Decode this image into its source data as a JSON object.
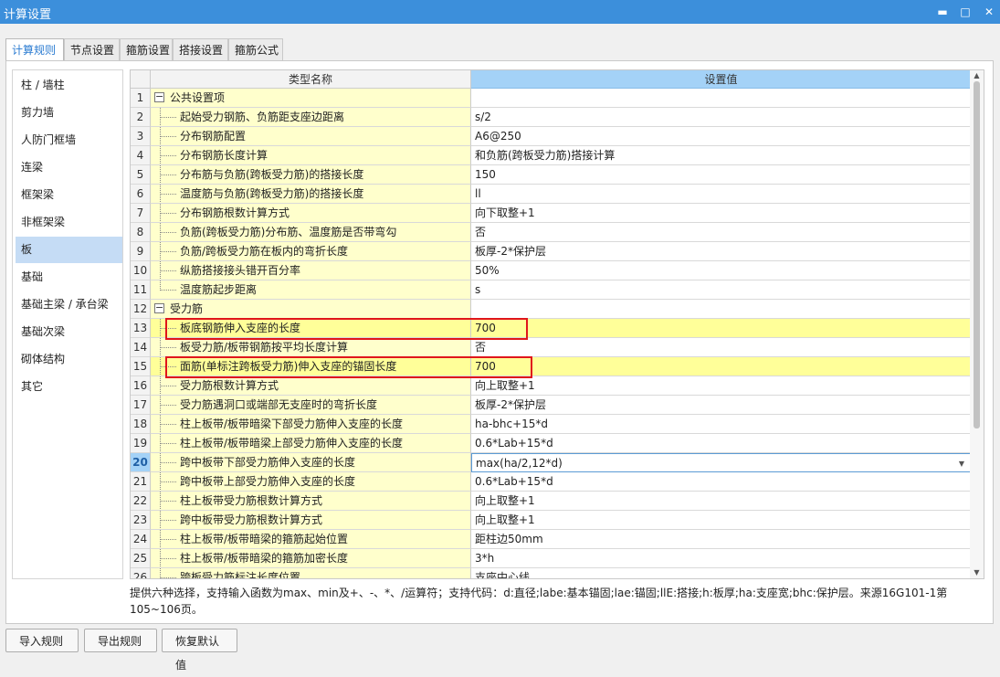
{
  "window": {
    "title": "计算设置",
    "min": "▬",
    "max": "□",
    "close": "✕"
  },
  "tabs": [
    "计算规则",
    "节点设置",
    "箍筋设置",
    "搭接设置",
    "箍筋公式"
  ],
  "categories": [
    "柱 / 墙柱",
    "剪力墙",
    "人防门框墙",
    "连梁",
    "框架梁",
    "非框架梁",
    "板",
    "基础",
    "基础主梁 / 承台梁",
    "基础次梁",
    "砌体结构",
    "其它"
  ],
  "grid": {
    "col_name": "类型名称",
    "col_value": "设置值",
    "rows": [
      {
        "num": "1",
        "name": "公共设置项",
        "value": "",
        "group": true
      },
      {
        "num": "2",
        "name": "起始受力钢筋、负筋距支座边距离",
        "value": "s/2"
      },
      {
        "num": "3",
        "name": "分布钢筋配置",
        "value": "A6@250"
      },
      {
        "num": "4",
        "name": "分布钢筋长度计算",
        "value": "和负筋(跨板受力筋)搭接计算"
      },
      {
        "num": "5",
        "name": "分布筋与负筋(跨板受力筋)的搭接长度",
        "value": "150"
      },
      {
        "num": "6",
        "name": "温度筋与负筋(跨板受力筋)的搭接长度",
        "value": "ll"
      },
      {
        "num": "7",
        "name": "分布钢筋根数计算方式",
        "value": "向下取整+1"
      },
      {
        "num": "8",
        "name": "负筋(跨板受力筋)分布筋、温度筋是否带弯勾",
        "value": "否"
      },
      {
        "num": "9",
        "name": "负筋/跨板受力筋在板内的弯折长度",
        "value": "板厚-2*保护层"
      },
      {
        "num": "10",
        "name": "纵筋搭接接头错开百分率",
        "value": "50%"
      },
      {
        "num": "11",
        "name": "温度筋起步距离",
        "value": "s"
      },
      {
        "num": "12",
        "name": "受力筋",
        "value": "",
        "group": true
      },
      {
        "num": "13",
        "name": "板底钢筋伸入支座的长度",
        "value": "700"
      },
      {
        "num": "14",
        "name": "板受力筋/板带钢筋按平均长度计算",
        "value": "否"
      },
      {
        "num": "15",
        "name": "面筋(单标注跨板受力筋)伸入支座的锚固长度",
        "value": "700"
      },
      {
        "num": "16",
        "name": "受力筋根数计算方式",
        "value": "向上取整+1"
      },
      {
        "num": "17",
        "name": "受力筋遇洞口或端部无支座时的弯折长度",
        "value": "板厚-2*保护层"
      },
      {
        "num": "18",
        "name": "柱上板带/板带暗梁下部受力筋伸入支座的长度",
        "value": "ha-bhc+15*d"
      },
      {
        "num": "19",
        "name": "柱上板带/板带暗梁上部受力筋伸入支座的长度",
        "value": "0.6*Lab+15*d"
      },
      {
        "num": "20",
        "name": "跨中板带下部受力筋伸入支座的长度",
        "value": "max(ha/2,12*d)"
      },
      {
        "num": "21",
        "name": "跨中板带上部受力筋伸入支座的长度",
        "value": "0.6*Lab+15*d"
      },
      {
        "num": "22",
        "name": "柱上板带受力筋根数计算方式",
        "value": "向上取整+1"
      },
      {
        "num": "23",
        "name": "跨中板带受力筋根数计算方式",
        "value": "向上取整+1"
      },
      {
        "num": "24",
        "name": "柱上板带/板带暗梁的箍筋起始位置",
        "value": "距柱边50mm"
      },
      {
        "num": "25",
        "name": "柱上板带/板带暗梁的箍筋加密长度",
        "value": "3*h"
      },
      {
        "num": "26",
        "name": "跨板受力筋标注长度位置",
        "value": "支座中心线"
      }
    ]
  },
  "hint": "提供六种选择，支持输入函数为max、min及+、-、*、/运算符；支持代码：d:直径;labe:基本锚固;lae:锚固;llE:搭接;h:板厚;ha:支座宽;bhc:保护层。来源16G101-1第105~106页。",
  "buttons": [
    "导入规则",
    "导出规则",
    "恢复默认值"
  ],
  "colors": {
    "accent": "#3c8fdb",
    "highlight_row": "#ffff99",
    "name_cell": "#ffffcc",
    "annotation": "#e0161b"
  }
}
